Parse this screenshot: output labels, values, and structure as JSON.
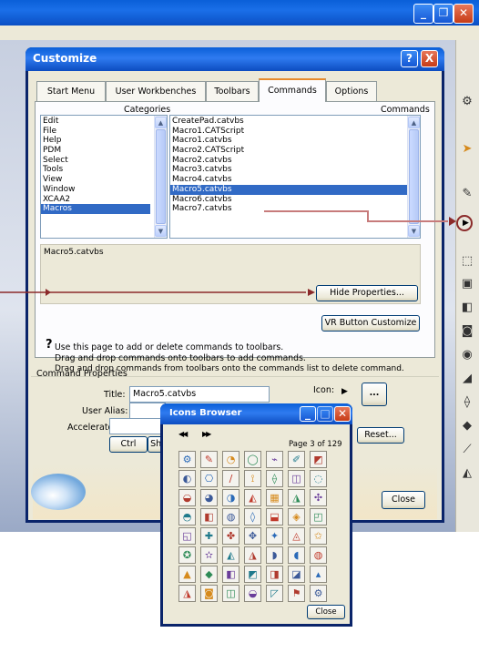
{
  "dialog": {
    "title": "Customize",
    "help_btn": "?",
    "close_btn": "X",
    "tabs": [
      {
        "label": "Start Menu"
      },
      {
        "label": "User Workbenches"
      },
      {
        "label": "Toolbars"
      },
      {
        "label": "Commands",
        "active": true
      },
      {
        "label": "Options"
      }
    ],
    "categories_label": "Categories",
    "commands_label": "Commands",
    "categories": [
      "Edit",
      "File",
      "Help",
      "PDM",
      "Select",
      "Tools",
      "View",
      "Window",
      "XCAA2",
      "Macros"
    ],
    "selected_category": "Macros",
    "commands": [
      "CreatePad.catvbs",
      "Macro1.CATScript",
      "Macro1.catvbs",
      "Macro2.CATScript",
      "Macro2.catvbs",
      "Macro3.catvbs",
      "Macro4.catvbs",
      "Macro5.catvbs",
      "Macro6.catvbs",
      "Macro7.catvbs"
    ],
    "selected_command": "Macro5.catvbs",
    "info_text": "Macro5.catvbs",
    "hide_properties_btn": "Hide Properties...",
    "vr_button": "VR Button Customize",
    "help_lines": [
      "Use this page to add or delete commands to toolbars.",
      "Drag and drop commands onto toolbars to add commands.",
      "Drag and drop commands from toolbars onto the commands list to delete command."
    ],
    "command_properties": {
      "legend": "Command Properties",
      "title_label": "Title:",
      "title_value": "Macro5.catvbs",
      "user_alias_label": "User Alias:",
      "user_alias_value": "",
      "accelerator_label": "Accelerator:",
      "accelerator_value": "",
      "icon_label": "Icon:",
      "browse_btn": "...",
      "ctrl_btn": "Ctrl",
      "shift_btn": "Shi",
      "reset_btn": "Reset...",
      "close_btn": "Close"
    }
  },
  "icons_browser": {
    "title": "Icons Browser",
    "nav_first": "◀◀",
    "nav_next": "▶▶",
    "page_text": "Page 3 of 129",
    "close_btn": "Close"
  },
  "colors": {
    "xp_blue": "#0a5fd8",
    "selection": "#316ac5",
    "arrow": "#8b2a2a"
  }
}
